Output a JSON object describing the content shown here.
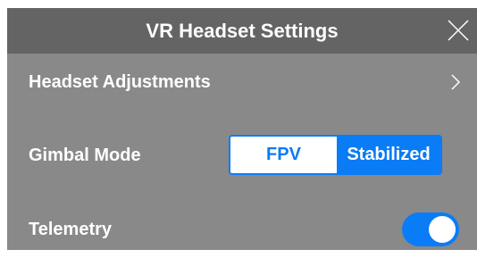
{
  "dialog": {
    "title": "VR Headset Settings",
    "close_icon": "close-icon"
  },
  "rows": {
    "headset_adjustments": {
      "label": "Headset Adjustments",
      "icon": "chevron-right-icon"
    },
    "gimbal_mode": {
      "label": "Gimbal Mode",
      "options": [
        "FPV",
        "Stabilized"
      ],
      "selected": "Stabilized"
    },
    "telemetry": {
      "label": "Telemetry",
      "enabled": true
    }
  },
  "colors": {
    "header_bg": "#646464",
    "panel_bg": "#898989",
    "accent": "#0a7cf6",
    "text": "#ffffff"
  }
}
